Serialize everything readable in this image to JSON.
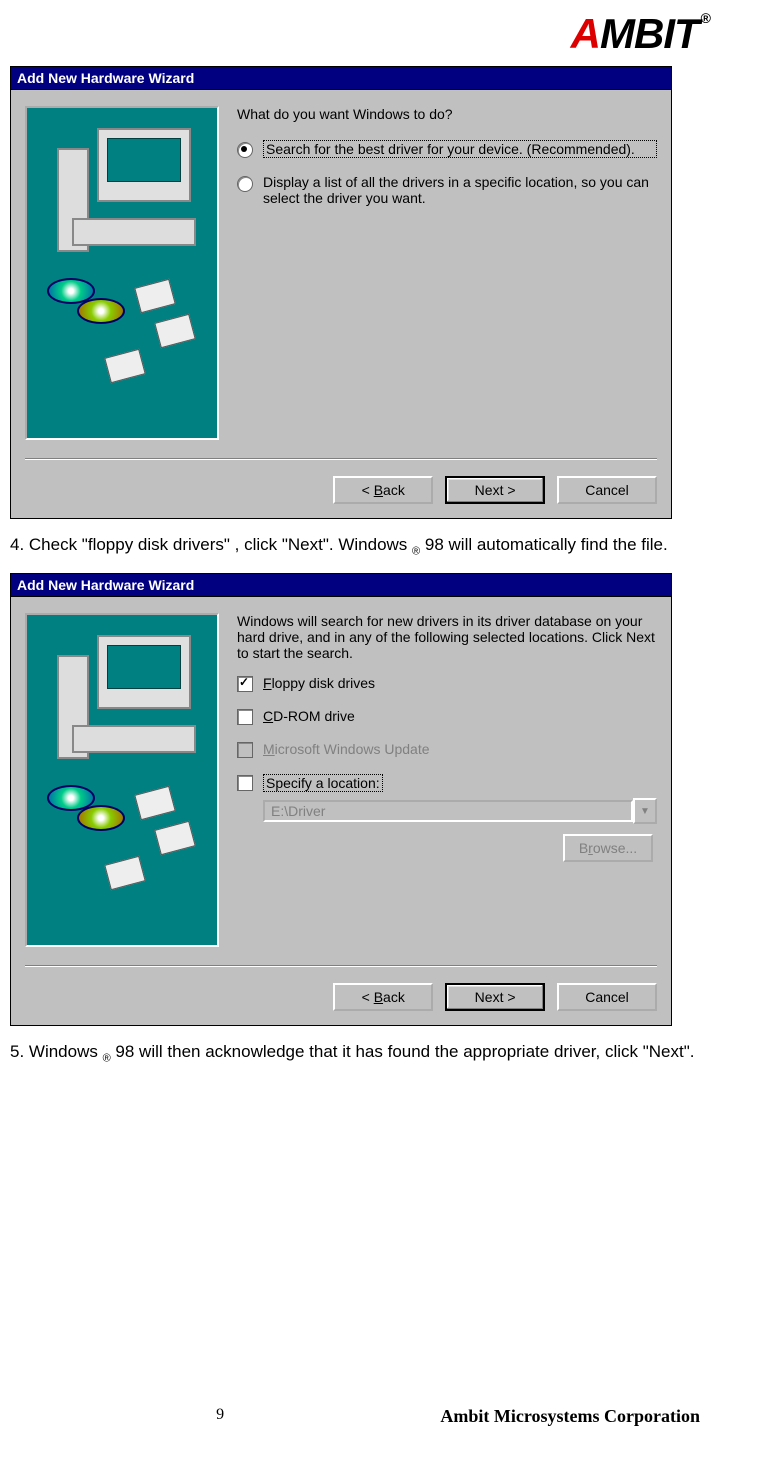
{
  "logo": {
    "brand_a": "A",
    "brand_rest": "MBIT",
    "reg": "®"
  },
  "wizard1": {
    "title": "Add New Hardware Wizard",
    "prompt": "What do you want Windows to do?",
    "opt1": "Search for the best driver for your device. (Recommended).",
    "opt2": "Display a list of all the drivers in a specific location, so you can select the driver you want.",
    "back": "< Back",
    "next": "Next >",
    "cancel": "Cancel"
  },
  "step4_a": "4. Check \"floppy disk drivers\" , click \"Next\". Windows ",
  "step4_reg": "®",
  "step4_b": " 98 will automatically find the file.",
  "wizard2": {
    "title": "Add New Hardware Wizard",
    "intro": "Windows will search for new drivers in its driver database on your hard drive, and in any of the following selected locations. Click Next to start the search.",
    "chk_floppy": "Floppy disk drives",
    "chk_cdrom": "CD-ROM drive",
    "chk_msupdate": "Microsoft Windows Update",
    "chk_specify": "Specify a location:",
    "path": "E:\\Driver",
    "browse": "Browse...",
    "back": "< Back",
    "next": "Next >",
    "cancel": "Cancel"
  },
  "step5_a": "5. Windows ",
  "step5_reg": "®",
  "step5_b": " 98 will then acknowledge that it has found the appropriate driver, click \"Next\".",
  "footer": {
    "page": "9",
    "corp": "Ambit Microsystems Corporation"
  }
}
